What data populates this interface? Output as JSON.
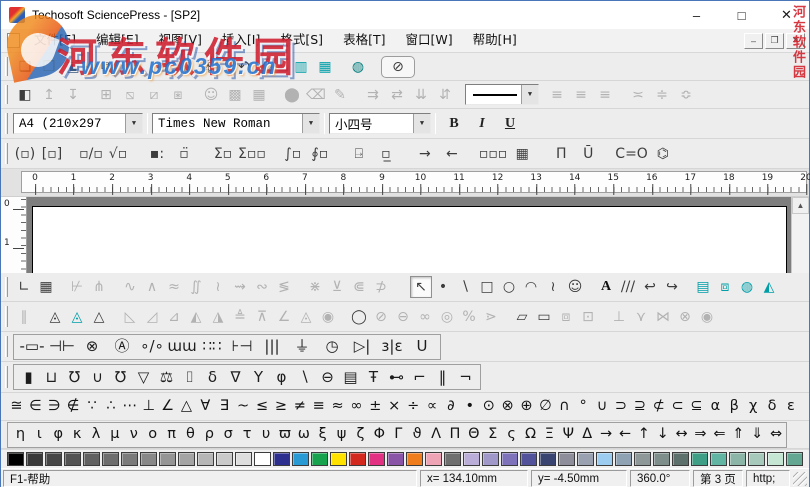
{
  "window": {
    "title": "Techosoft SciencePress - [SP2]",
    "controls": {
      "min": "–",
      "max": "□",
      "close": "✕"
    },
    "mdi": {
      "min": "–",
      "restore": "❐",
      "close": "✕"
    }
  },
  "menu": {
    "items": [
      {
        "name": "menu-file",
        "glyph": "文件[F]"
      },
      {
        "name": "menu-edit",
        "glyph": "编辑[E]"
      },
      {
        "name": "menu-view",
        "glyph": "视图[V]"
      },
      {
        "name": "menu-insert",
        "glyph": "插入[I]"
      },
      {
        "name": "menu-format",
        "glyph": "格式[S]"
      },
      {
        "name": "menu-table",
        "glyph": "表格[T]"
      },
      {
        "name": "menu-window",
        "glyph": "窗口[W]"
      },
      {
        "name": "menu-help",
        "glyph": "帮助[H]"
      }
    ]
  },
  "toolbars": {
    "standard": [
      {
        "name": "new-document-icon",
        "glyph": "❏"
      },
      {
        "name": "open-icon",
        "glyph": "❒",
        "cls": "folder"
      },
      {
        "name": "save-icon",
        "glyph": "▣",
        "cls": "navy"
      },
      {
        "sep": true
      },
      {
        "name": "print-preview-icon",
        "glyph": "⧉"
      },
      {
        "name": "print-icon",
        "glyph": "⎙"
      },
      {
        "sep": true
      },
      {
        "name": "cut-icon",
        "glyph": "✂",
        "disabled": true
      },
      {
        "name": "copy-icon",
        "glyph": "⎘",
        "disabled": true
      },
      {
        "name": "paste-icon",
        "glyph": "⎗"
      },
      {
        "sep": true
      },
      {
        "name": "undo-icon",
        "glyph": "↶"
      },
      {
        "name": "redo-icon",
        "glyph": "↷",
        "disabled": true
      },
      {
        "sep": true
      },
      {
        "name": "table-columns-icon",
        "glyph": "▥",
        "cls": "cyan"
      },
      {
        "name": "table-layout-icon",
        "glyph": "▦",
        "cls": "cyan"
      },
      {
        "sep": true
      },
      {
        "name": "database-icon",
        "glyph": "◍",
        "cls": "teal"
      },
      {
        "sep": true
      },
      {
        "name": "equation-editor-button",
        "glyph": "⊘",
        "btn": true
      }
    ],
    "table_tools": [
      {
        "name": "table-format-icon",
        "glyph": "◧"
      },
      {
        "name": "insert-row-above-icon",
        "glyph": "↥",
        "disabled": true
      },
      {
        "name": "insert-row-below-icon",
        "glyph": "↧",
        "disabled": true
      },
      {
        "sep": true
      },
      {
        "name": "border-all-icon",
        "glyph": "⊞",
        "disabled": true
      },
      {
        "name": "border-diagonal-down-icon",
        "glyph": "⧅",
        "disabled": true
      },
      {
        "name": "border-diagonal-up-icon",
        "glyph": "⧄",
        "disabled": true
      },
      {
        "name": "border-diagonal-cross-icon",
        "glyph": "⧆",
        "disabled": true
      },
      {
        "sep": true
      },
      {
        "name": "portrait-icon",
        "glyph": "☺",
        "disabled": true
      },
      {
        "name": "shading-icon",
        "glyph": "▩",
        "disabled": true
      },
      {
        "name": "table-grid-icon",
        "glyph": "▦",
        "disabled": true
      },
      {
        "sep": true
      },
      {
        "name": "fill-color-icon",
        "glyph": "⬤",
        "disabled": true
      },
      {
        "name": "eraser-icon",
        "glyph": "⌫",
        "disabled": true
      },
      {
        "name": "pen-icon",
        "glyph": "✎",
        "disabled": true
      },
      {
        "sep": true
      },
      {
        "name": "merge-cells-right-icon",
        "glyph": "⇉",
        "disabled": true
      },
      {
        "name": "split-cells-right-icon",
        "glyph": "⇄",
        "disabled": true
      },
      {
        "name": "merge-cells-down-icon",
        "glyph": "⇊",
        "disabled": true
      },
      {
        "name": "split-cells-down-icon",
        "glyph": "⇵",
        "disabled": true
      }
    ],
    "align_tools": [
      {
        "name": "align-left-icon",
        "glyph": "≡",
        "disabled": true
      },
      {
        "name": "align-center-icon",
        "glyph": "≡",
        "disabled": true
      },
      {
        "name": "align-right-icon",
        "glyph": "≡",
        "disabled": true
      },
      {
        "sep": true
      },
      {
        "name": "valign-top-icon",
        "glyph": "≍",
        "disabled": true
      },
      {
        "name": "valign-middle-icon",
        "glyph": "≑",
        "disabled": true
      },
      {
        "name": "valign-bottom-icon",
        "glyph": "≎",
        "disabled": true
      }
    ],
    "format": {
      "page_size": "A4  (210x297",
      "font_name": "Times New Roman",
      "font_size": "小四号",
      "bold": "B",
      "italic": "I",
      "underline": "U"
    },
    "equation": [
      {
        "name": "paren-template",
        "glyph": "(▫)"
      },
      {
        "name": "bracket-template",
        "glyph": "[▫]"
      },
      {
        "sep": true
      },
      {
        "name": "fraction-template",
        "glyph": "▫/▫"
      },
      {
        "name": "radical-template",
        "glyph": "√▫"
      },
      {
        "sep": true
      },
      {
        "name": "script-template",
        "glyph": "▪:"
      },
      {
        "name": "accent-template",
        "glyph": "▫̈"
      },
      {
        "sep": true
      },
      {
        "name": "sum-template",
        "glyph": "Σ▫"
      },
      {
        "name": "sum-limits-template",
        "glyph": "Σ▫▫"
      },
      {
        "sep": true
      },
      {
        "name": "integral-template",
        "glyph": "∫▫"
      },
      {
        "name": "contour-integral-template",
        "glyph": "∮▫"
      },
      {
        "sep": true
      },
      {
        "name": "boxed-arrow-template",
        "glyph": "⍈"
      },
      {
        "name": "underline-template",
        "glyph": "▫̲"
      },
      {
        "sep": true
      },
      {
        "name": "reaction-arrow-right-icon",
        "glyph": "→"
      },
      {
        "name": "reaction-arrow-left-icon",
        "glyph": "←"
      },
      {
        "sep": true
      },
      {
        "name": "row-vector-template",
        "glyph": "▫▫▫"
      },
      {
        "name": "matrix-template",
        "glyph": "▦"
      },
      {
        "sep": true
      },
      {
        "name": "product-template",
        "glyph": "Π̄"
      },
      {
        "name": "union-template",
        "glyph": "Ū"
      },
      {
        "sep": true
      },
      {
        "name": "carbonyl-bond-icon",
        "glyph": "C=O"
      },
      {
        "name": "benzene-ring-icon",
        "glyph": "⌬"
      }
    ],
    "plot_tools": [
      {
        "name": "chart-axes-icon",
        "glyph": "∟"
      },
      {
        "name": "chart-grid-icon",
        "glyph": "▦"
      },
      {
        "sep": true
      },
      {
        "name": "plot-clip-tool",
        "glyph": "⊬",
        "disabled": true
      },
      {
        "name": "plot-fork-tool",
        "glyph": "⋔",
        "disabled": true
      },
      {
        "sep": true
      },
      {
        "name": "plot-curve-tool-1",
        "glyph": "∿",
        "disabled": true
      },
      {
        "name": "plot-curve-tool-2",
        "glyph": "∧",
        "disabled": true
      },
      {
        "name": "plot-curve-tool-3",
        "glyph": "≈",
        "disabled": true
      },
      {
        "name": "plot-curve-tool-4",
        "glyph": "∬",
        "disabled": true
      },
      {
        "name": "plot-curve-tool-5",
        "glyph": "≀",
        "disabled": true
      },
      {
        "name": "plot-curve-tool-6",
        "glyph": "⇝",
        "disabled": true
      },
      {
        "name": "plot-curve-tool-7",
        "glyph": "∾",
        "disabled": true
      },
      {
        "name": "plot-curve-tool-8",
        "glyph": "≶",
        "disabled": true
      },
      {
        "sep": true
      },
      {
        "name": "plot-scatter-tool",
        "glyph": "⋇",
        "disabled": true
      },
      {
        "name": "plot-step-tool",
        "glyph": "⊻",
        "disabled": true
      },
      {
        "name": "plot-region-tool",
        "glyph": "⋐",
        "disabled": true
      },
      {
        "name": "plot-open-curve-tool",
        "glyph": "⊅",
        "disabled": true
      },
      {
        "sep": true
      },
      {
        "sep": true
      },
      {
        "name": "select-tool",
        "glyph": "↖",
        "pressed": true
      },
      {
        "name": "point-tool",
        "glyph": "•"
      },
      {
        "name": "line-tool",
        "glyph": "∖"
      },
      {
        "name": "rectangle-tool",
        "glyph": "□"
      },
      {
        "name": "ellipse-tool",
        "glyph": "○"
      },
      {
        "name": "arc-tool",
        "glyph": "◠"
      },
      {
        "name": "curve-tool",
        "glyph": "≀"
      },
      {
        "name": "portrait-tool",
        "glyph": "☺"
      },
      {
        "sep": true
      },
      {
        "name": "text-tool",
        "glyph": "A",
        "cls": "serifB"
      },
      {
        "name": "hatch-tool",
        "glyph": "///"
      },
      {
        "name": "corner-arrow-left-tool",
        "glyph": "↩"
      },
      {
        "name": "corner-arrow-right-tool",
        "glyph": "↪"
      },
      {
        "sep": true
      },
      {
        "name": "cylinder-tool",
        "glyph": "▤",
        "cls": "cyan"
      },
      {
        "name": "cube-tool",
        "glyph": "⧈",
        "cls": "cyan"
      },
      {
        "name": "sphere-tool",
        "glyph": "◍",
        "cls": "cyan"
      },
      {
        "name": "cone-tool",
        "glyph": "◭",
        "cls": "cyan"
      }
    ],
    "shape_tools": [
      {
        "name": "parallel-lines-icon",
        "glyph": "∥",
        "disabled": true
      },
      {
        "sep": true
      },
      {
        "name": "triangle-dotted-icon",
        "glyph": "◬"
      },
      {
        "name": "triangle-shaded-icon",
        "glyph": "◬",
        "cls": "cyan"
      },
      {
        "name": "triangle-icon",
        "glyph": "△"
      },
      {
        "sep": true
      },
      {
        "name": "triangle-left-icon",
        "glyph": "◺",
        "disabled": true
      },
      {
        "name": "triangle-right-icon",
        "glyph": "◿",
        "disabled": true
      },
      {
        "name": "triangle-wedge-icon",
        "glyph": "⊿",
        "disabled": true
      },
      {
        "name": "triangle-left-fill-icon",
        "glyph": "◭",
        "disabled": true
      },
      {
        "name": "triangle-right-fill-icon",
        "glyph": "◮",
        "disabled": true
      },
      {
        "name": "triangle-base-icon",
        "glyph": "≜",
        "disabled": true
      },
      {
        "name": "triangle-apex-icon",
        "glyph": "⊼",
        "disabled": true
      },
      {
        "name": "angle-icon",
        "glyph": "∠",
        "disabled": true
      },
      {
        "name": "triangle-in-circle-icon",
        "glyph": "◬",
        "disabled": true
      },
      {
        "name": "triangle-circled-icon",
        "glyph": "◉",
        "disabled": true
      },
      {
        "sep": true
      },
      {
        "name": "circle-icon",
        "glyph": "◯"
      },
      {
        "name": "circle-slash-icon",
        "glyph": "⊘",
        "disabled": true
      },
      {
        "name": "circle-chord-icon",
        "glyph": "⊖",
        "disabled": true
      },
      {
        "name": "linked-circles-icon",
        "glyph": "∞",
        "disabled": true
      },
      {
        "name": "concentric-circles-icon",
        "glyph": "◎",
        "disabled": true
      },
      {
        "name": "small-circles-icon",
        "glyph": "%",
        "disabled": true
      },
      {
        "name": "circle-arrow-icon",
        "glyph": "⋗",
        "disabled": true
      },
      {
        "sep": true
      },
      {
        "name": "parallelogram-icon",
        "glyph": "▱"
      },
      {
        "name": "rectangle-shape-icon",
        "glyph": "▭"
      },
      {
        "name": "inset-square-icon",
        "glyph": "⧈",
        "disabled": true
      },
      {
        "name": "inset-circle-icon",
        "glyph": "⊡",
        "disabled": true
      },
      {
        "sep": true
      },
      {
        "name": "perpendicular-icon",
        "glyph": "⊥",
        "disabled": true
      },
      {
        "name": "fork-icon",
        "glyph": "⋎",
        "disabled": true
      },
      {
        "name": "bowtie-icon",
        "glyph": "⋈",
        "disabled": true
      },
      {
        "name": "crossed-circle-icon",
        "glyph": "⊗",
        "disabled": true
      },
      {
        "name": "bullseye-icon",
        "glyph": "◉",
        "disabled": true
      }
    ],
    "circuit_tools": [
      {
        "name": "resistor-icon",
        "glyph": "-▭-"
      },
      {
        "name": "capacitor-icon",
        "glyph": "⊣⊢"
      },
      {
        "name": "lamp-icon",
        "glyph": "⊗"
      },
      {
        "name": "ammeter-icon",
        "glyph": "Ⓐ"
      },
      {
        "name": "switch-icon",
        "glyph": "∘/∘"
      },
      {
        "name": "inductor-icon",
        "glyph": "ɯɯ"
      },
      {
        "name": "dot-grid-icon",
        "glyph": "∷∷"
      },
      {
        "name": "battery-icon",
        "glyph": "⊦⊣"
      },
      {
        "name": "multicell-battery-icon",
        "glyph": "|||"
      },
      {
        "name": "ground-icon",
        "glyph": "⏚"
      },
      {
        "name": "meter-icon",
        "glyph": "◷"
      },
      {
        "name": "diode-icon",
        "glyph": "▷|",
        "cls": "red"
      },
      {
        "name": "transformer-icon",
        "glyph": "ɜ|ɛ",
        "cls": "red"
      },
      {
        "name": "magnet-icon",
        "glyph": "U"
      }
    ],
    "chemistry_tools": [
      {
        "name": "test-tube-icon",
        "glyph": "▮",
        "cls": "cyan"
      },
      {
        "name": "beaker-icon",
        "glyph": "⊔",
        "cls": "magenta"
      },
      {
        "name": "round-flask-icon",
        "glyph": "℧",
        "cls": "green"
      },
      {
        "name": "flat-flask-icon",
        "glyph": "∪"
      },
      {
        "name": "distilling-flask-icon",
        "glyph": "℧"
      },
      {
        "name": "conical-flask-icon",
        "glyph": "▽",
        "cls": "magenta"
      },
      {
        "name": "balance-icon",
        "glyph": "⚖"
      },
      {
        "name": "reagent-bottle-icon",
        "glyph": "⌷"
      },
      {
        "name": "dropper-icon",
        "glyph": "δ",
        "cls": "cyan"
      },
      {
        "name": "funnel-icon",
        "glyph": "∇"
      },
      {
        "name": "separating-funnel-icon",
        "glyph": "Y",
        "cls": "cyan"
      },
      {
        "name": "burette-icon",
        "glyph": "φ",
        "cls": "magenta"
      },
      {
        "name": "stirring-rod-icon",
        "glyph": "∖"
      },
      {
        "name": "evaporating-dish-icon",
        "glyph": "⊖"
      },
      {
        "name": "graduated-cylinder-icon",
        "glyph": "▤",
        "cls": "green"
      },
      {
        "name": "ring-stand-icon",
        "glyph": "Ŧ"
      },
      {
        "name": "clamp-icon",
        "glyph": "⊷"
      },
      {
        "name": "bent-tube-icon",
        "glyph": "⌐"
      },
      {
        "name": "parallel-tubes-icon",
        "glyph": "‖"
      },
      {
        "name": "bent-tube-right-icon",
        "glyph": "¬"
      }
    ],
    "math_symbols": [
      "≅",
      "∈",
      "∋",
      "∉",
      "∵",
      "∴",
      "⋯",
      "⊥",
      "∠",
      "△",
      "∀",
      "∃",
      "~",
      "≤",
      "≥",
      "≠",
      "≡",
      "≈",
      "∞",
      "±",
      "×",
      "÷",
      "∝",
      "∂",
      "•",
      "⊙",
      "⊗",
      "⊕",
      "∅",
      "∩",
      "°",
      "∪",
      "⊃",
      "⊇",
      "⊄",
      "⊂",
      "⊆",
      "α",
      "β",
      "χ",
      "δ",
      "ε"
    ],
    "greek_symbols": [
      "η",
      "ι",
      "φ",
      "κ",
      "λ",
      "μ",
      "ν",
      "ο",
      "π",
      "θ",
      "ρ",
      "σ",
      "τ",
      "υ",
      "ϖ",
      "ω",
      "ξ",
      "ψ",
      "ζ",
      "Φ",
      "Γ",
      "ϑ",
      "Λ",
      "Π",
      "Θ",
      "Σ",
      "ς",
      "Ω",
      "Ξ",
      "Ψ",
      "Δ",
      "→",
      "←",
      "↑",
      "↓",
      "↔",
      "⇒",
      "⇐",
      "⇑",
      "⇓",
      "⇔"
    ]
  },
  "ruler": {
    "h_numbers": [
      0,
      1,
      2,
      3,
      4,
      5,
      6,
      7,
      8,
      9,
      10,
      11,
      12,
      13,
      14,
      15,
      16,
      17,
      18,
      19,
      20
    ],
    "v_numbers": [
      0,
      1
    ]
  },
  "palette": {
    "colors": [
      "#000000",
      "#3a3a3a",
      "#474747",
      "#545454",
      "#616161",
      "#6e6e6e",
      "#7b7b7b",
      "#888888",
      "#959595",
      "#a4a4a4",
      "#b6b6b6",
      "#cacaca",
      "#dedede",
      "#ffffff",
      "#2d2f8f",
      "#2a9ad4",
      "#17a24e",
      "#ffe200",
      "#d2281e",
      "#e23082",
      "#8a55a6",
      "#ef7d1e",
      "#efa4b6",
      "#6f6f6f",
      "#baaed8",
      "#a098c8",
      "#7e72ba",
      "#52529a",
      "#3a4470",
      "#8e8e9a",
      "#9aa2b2",
      "#9ccdf0",
      "#8ea2b4",
      "#8e9898",
      "#7e8e8a",
      "#5e706c",
      "#3f9e86",
      "#63b5a3",
      "#8cb5a8",
      "#a6c9bc",
      "#c6e6d4",
      "#63a692"
    ]
  },
  "status": {
    "help": "F1-帮助",
    "x": "x= 134.10mm",
    "y": "y= -4.50mm",
    "angle": "360.0°",
    "page": "第 3 页",
    "link": "http;"
  },
  "watermark": {
    "brand": "河东软件园",
    "url": "www.pc0359.cn",
    "side": "河东软件园"
  },
  "ui": {
    "dropdown_arrow": "▼",
    "scroll_up": "▲"
  }
}
